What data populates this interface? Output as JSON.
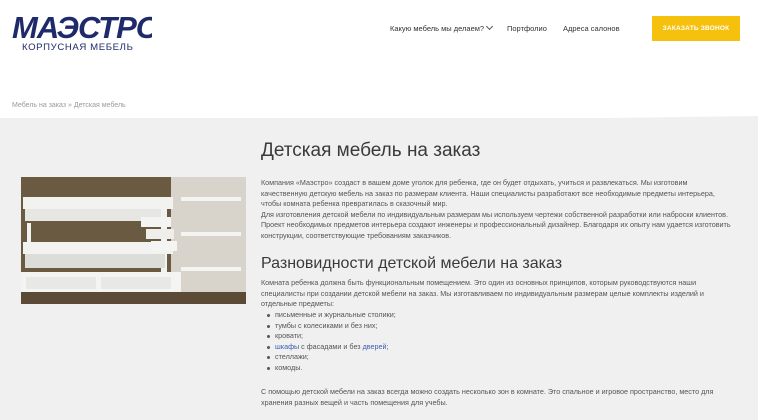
{
  "header": {
    "logo_main": "МАЭСТРО",
    "logo_sub": "КОРПУСНАЯ МЕБЕЛЬ",
    "nav": [
      {
        "label": "Какую мебель мы делаем?",
        "has_dropdown": true,
        "icon": "chevron-down-icon"
      },
      {
        "label": "Портфолио"
      },
      {
        "label": "Адреса салонов"
      }
    ],
    "cta_label": "ЗАКАЗАТЬ ЗВОНОК"
  },
  "breadcrumb": {
    "home": "Мебель на заказ",
    "sep": "»",
    "current": "Детская мебель"
  },
  "main": {
    "title": "Детская мебель на заказ",
    "intro": [
      "Компания «Маэстро» создаст в вашем доме уголок для ребенка, где он будет отдыхать, учиться и развлекаться. Мы изготовим качественную детскую мебель на заказ по размерам клиента. Наши специалисты разработают все необходимые предметы интерьера, чтобы комната ребенка превратилась в сказочный мир.",
      "Для изготовления детской мебели по индивидуальным размерам мы используем чертежи собственной разработки или наброски клиентов. Проект необходимых предметов интерьера создают инженеры и профессиональный дизайнер. Благодаря их опыту нам удается изготовить конструкции, соответствующие требованиям заказчиков."
    ],
    "subtitle": "Разновидности детской мебели на заказ",
    "types_text": "Комната ребенка должна быть функциональным помещением. Это один из основных принципов, которым руководствуются наши специалисты при создании детской мебели на заказ. Мы изготавливаем по индивидуальным размерам целые комплекты изделий и отдельные предметы:",
    "list": {
      "item1": "письменные и журнальные столики;",
      "item2": "тумбы с колесиками и без них;",
      "item3": "кровати;",
      "item4_link1": "шкафы",
      "item4_mid": " с фасадами и без ",
      "item4_link2": "дверей",
      "item4_end": ";",
      "item5": "стеллажи;",
      "item6": "комоды."
    },
    "outro": "С помощью детской мебели на заказ всегда можно создать несколько зон в комнате. Это спальное и игровое пространство, место для хранения разных вещей и часть помещения для учебы."
  },
  "colors": {
    "brand_navy": "#1f2a6b",
    "accent_yellow": "#f6c10d",
    "link_blue": "#3c5db0",
    "section_bg": "#f0f0f0"
  }
}
